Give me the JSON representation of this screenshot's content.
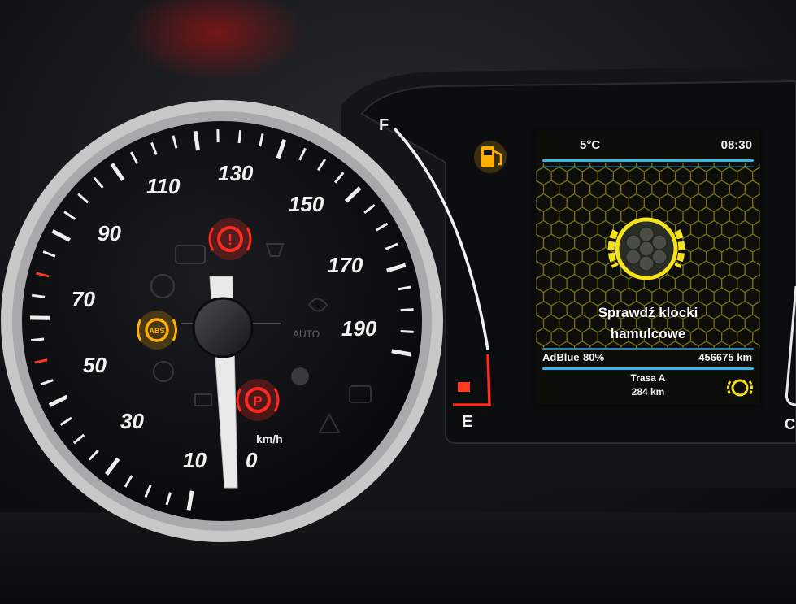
{
  "speedometer": {
    "labels": [
      "0",
      "10",
      "30",
      "50",
      "70",
      "90",
      "110",
      "130",
      "150",
      "170",
      "190"
    ],
    "unit": "km/h"
  },
  "fuel_gauge": {
    "full_label": "F",
    "empty_label": "E"
  },
  "display": {
    "temperature": "5°C",
    "time": "08:30",
    "message_line1": "Sprawdź klocki",
    "message_line2": "hamulcowe",
    "adblue_label": "AdBlue",
    "adblue_value": "80%",
    "odometer": "456675 km",
    "trip_label": "Trasa A",
    "trip_value": "284 km"
  },
  "warning_lights": {
    "abs": "ABS",
    "parking": "P",
    "brake": "!",
    "auto": "AUTO"
  },
  "colors": {
    "red_lamp": "#ff2a1f",
    "amber_lamp": "#ffb000",
    "display_yellow": "#f5e21a",
    "display_cyan": "#35b8e8",
    "dial_ring": "#c9c9c9"
  },
  "side_label": "C"
}
